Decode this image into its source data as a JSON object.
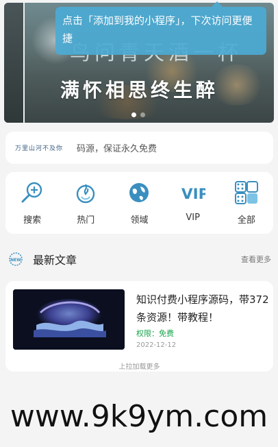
{
  "tooltip": {
    "text": "点击「添加到我的小程序」，下次访问更便捷"
  },
  "banner": {
    "calligraphy_line1": "鸟问青天酒一杯",
    "calligraphy_line2": "满怀相思终生醉",
    "slide_count": 2,
    "active_slide": 1
  },
  "notice": {
    "logo_text": "万里山河不及你",
    "text": "码源，保证永久免费"
  },
  "nav": [
    {
      "label": "搜索",
      "icon": "search-icon"
    },
    {
      "label": "热门",
      "icon": "fire-icon"
    },
    {
      "label": "领域",
      "icon": "globe-icon"
    },
    {
      "label": "VIP",
      "icon": "vip-icon"
    },
    {
      "label": "全部",
      "icon": "grid-icon"
    }
  ],
  "section": {
    "title": "最新文章",
    "more": "查看更多",
    "badge": "NEW"
  },
  "article": {
    "title": "知识付费小程序源码，带372条资源！带教程！",
    "permission": "权限：免费",
    "date": "2022-12-12"
  },
  "load_more": "上拉加载更多",
  "watermark": "www.9k9ym.com",
  "colors": {
    "accent": "#3a8fbf",
    "tooltip_bg": "#4caad4",
    "free_green": "#16a34a",
    "background": "#f4f4f5"
  }
}
